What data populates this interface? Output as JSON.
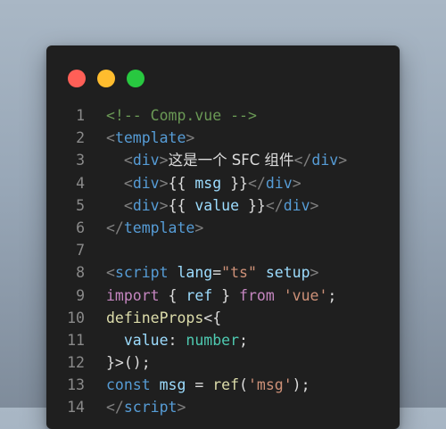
{
  "colors": {
    "background_top": "#a9b7c5",
    "background_bottom": "#7f8c9b",
    "window": "#1f1f1f",
    "close": "#ff5f57",
    "minimize": "#febc2e",
    "maximize": "#28c840",
    "line_number": "#8a8a8a",
    "comment": "#6a9955",
    "bracket": "#808080",
    "tag": "#569cd6",
    "attribute": "#9cdcfe",
    "string": "#ce9178",
    "keyword": "#c586c0",
    "function": "#dcdcaa",
    "type": "#4ec9b0",
    "text": "#dcdcdc"
  },
  "window_controls": [
    {
      "name": "close-dot",
      "color": "#ff5f57"
    },
    {
      "name": "minimize-dot",
      "color": "#febc2e"
    },
    {
      "name": "maximize-dot",
      "color": "#28c840"
    }
  ],
  "code_lines": [
    {
      "number": "1",
      "tokens": [
        {
          "t": "<!-- Comp.vue -->",
          "c": "comment"
        }
      ]
    },
    {
      "number": "2",
      "tokens": [
        {
          "t": "<",
          "c": "bracket"
        },
        {
          "t": "template",
          "c": "tag"
        },
        {
          "t": ">",
          "c": "bracket"
        }
      ]
    },
    {
      "number": "3",
      "tokens": [
        {
          "t": "  ",
          "c": "text"
        },
        {
          "t": "<",
          "c": "bracket"
        },
        {
          "t": "div",
          "c": "tag"
        },
        {
          "t": ">",
          "c": "bracket"
        },
        {
          "t": "这是一个 SFC 组件",
          "c": "text"
        },
        {
          "t": "</",
          "c": "bracket"
        },
        {
          "t": "div",
          "c": "tag"
        },
        {
          "t": ">",
          "c": "bracket"
        }
      ]
    },
    {
      "number": "4",
      "tokens": [
        {
          "t": "  ",
          "c": "text"
        },
        {
          "t": "<",
          "c": "bracket"
        },
        {
          "t": "div",
          "c": "tag"
        },
        {
          "t": ">",
          "c": "bracket"
        },
        {
          "t": "{{ ",
          "c": "text"
        },
        {
          "t": "msg",
          "c": "attribute"
        },
        {
          "t": " }}",
          "c": "text"
        },
        {
          "t": "</",
          "c": "bracket"
        },
        {
          "t": "div",
          "c": "tag"
        },
        {
          "t": ">",
          "c": "bracket"
        }
      ]
    },
    {
      "number": "5",
      "tokens": [
        {
          "t": "  ",
          "c": "text"
        },
        {
          "t": "<",
          "c": "bracket"
        },
        {
          "t": "div",
          "c": "tag"
        },
        {
          "t": ">",
          "c": "bracket"
        },
        {
          "t": "{{ ",
          "c": "text"
        },
        {
          "t": "value",
          "c": "attribute"
        },
        {
          "t": " }}",
          "c": "text"
        },
        {
          "t": "</",
          "c": "bracket"
        },
        {
          "t": "div",
          "c": "tag"
        },
        {
          "t": ">",
          "c": "bracket"
        }
      ]
    },
    {
      "number": "6",
      "tokens": [
        {
          "t": "</",
          "c": "bracket"
        },
        {
          "t": "template",
          "c": "tag"
        },
        {
          "t": ">",
          "c": "bracket"
        }
      ]
    },
    {
      "number": "7",
      "tokens": []
    },
    {
      "number": "8",
      "tokens": [
        {
          "t": "<",
          "c": "bracket"
        },
        {
          "t": "script",
          "c": "tag"
        },
        {
          "t": " ",
          "c": "text"
        },
        {
          "t": "lang",
          "c": "attribute"
        },
        {
          "t": "=",
          "c": "text"
        },
        {
          "t": "\"ts\"",
          "c": "string"
        },
        {
          "t": " ",
          "c": "text"
        },
        {
          "t": "setup",
          "c": "attribute"
        },
        {
          "t": ">",
          "c": "bracket"
        }
      ]
    },
    {
      "number": "9",
      "tokens": [
        {
          "t": "import",
          "c": "keyword"
        },
        {
          "t": " { ",
          "c": "text"
        },
        {
          "t": "ref",
          "c": "attribute"
        },
        {
          "t": " } ",
          "c": "text"
        },
        {
          "t": "from",
          "c": "keyword"
        },
        {
          "t": " ",
          "c": "text"
        },
        {
          "t": "'vue'",
          "c": "string"
        },
        {
          "t": ";",
          "c": "text"
        }
      ]
    },
    {
      "number": "10",
      "tokens": [
        {
          "t": "defineProps",
          "c": "function"
        },
        {
          "t": "<{",
          "c": "text"
        }
      ]
    },
    {
      "number": "11",
      "tokens": [
        {
          "t": "  ",
          "c": "text"
        },
        {
          "t": "value",
          "c": "attribute"
        },
        {
          "t": ": ",
          "c": "text"
        },
        {
          "t": "number",
          "c": "type"
        },
        {
          "t": ";",
          "c": "text"
        }
      ]
    },
    {
      "number": "12",
      "tokens": [
        {
          "t": "}>();",
          "c": "text"
        }
      ]
    },
    {
      "number": "13",
      "tokens": [
        {
          "t": "const",
          "c": "tag"
        },
        {
          "t": " ",
          "c": "text"
        },
        {
          "t": "msg",
          "c": "attribute"
        },
        {
          "t": " = ",
          "c": "text"
        },
        {
          "t": "ref",
          "c": "function"
        },
        {
          "t": "(",
          "c": "text"
        },
        {
          "t": "'msg'",
          "c": "string"
        },
        {
          "t": ");",
          "c": "text"
        }
      ]
    },
    {
      "number": "14",
      "tokens": [
        {
          "t": "</",
          "c": "bracket"
        },
        {
          "t": "script",
          "c": "tag"
        },
        {
          "t": ">",
          "c": "bracket"
        }
      ]
    }
  ]
}
